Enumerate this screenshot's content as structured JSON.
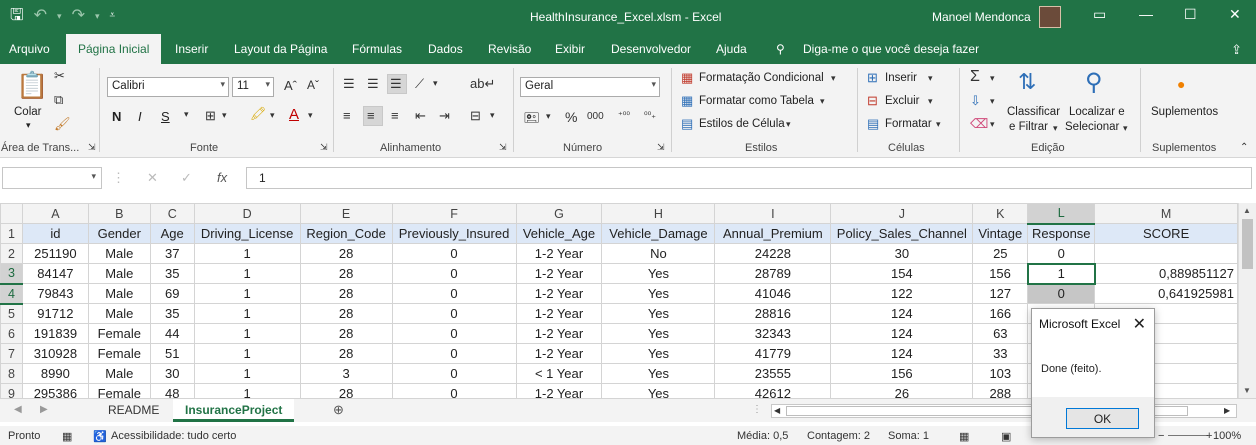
{
  "titlebar": {
    "title": "HealthInsurance_Excel.xlsm  -  Excel",
    "user": "Manoel Mendonca",
    "save_icon": "save-icon",
    "undo_icon": "undo-icon",
    "redo_icon": "redo-icon"
  },
  "tabs": {
    "file": "Arquivo",
    "home": "Página Inicial",
    "insert": "Inserir",
    "page_layout": "Layout da Página",
    "formulas": "Fórmulas",
    "data": "Dados",
    "review": "Revisão",
    "view": "Exibir",
    "developer": "Desenvolvedor",
    "help": "Ajuda",
    "tell_me": "Diga-me o que você deseja fazer"
  },
  "ribbon": {
    "clipboard": {
      "paste": "Colar",
      "label": "Área de Trans..."
    },
    "font": {
      "name": "Calibri",
      "size": "11",
      "bold": "N",
      "italic": "I",
      "underline": "S",
      "label": "Fonte"
    },
    "alignment": {
      "label": "Alinhamento"
    },
    "number": {
      "format": "Geral",
      "label": "Número"
    },
    "styles": {
      "conditional": "Formatação Condicional",
      "as_table": "Formatar como Tabela",
      "cell_styles": "Estilos de Célula",
      "label": "Estilos"
    },
    "cells": {
      "insert": "Inserir",
      "delete": "Excluir",
      "format": "Formatar",
      "label": "Células"
    },
    "editing": {
      "sort_filter_1": "Classificar",
      "sort_filter_2": "e Filtrar",
      "find_1": "Localizar e",
      "find_2": "Selecionar",
      "label": "Edição"
    },
    "addins": {
      "title": "Suplementos",
      "label": "Suplementos"
    }
  },
  "formula_bar": {
    "name_box": "",
    "value": "1"
  },
  "sheet": {
    "columns": [
      "A",
      "B",
      "C",
      "D",
      "E",
      "F",
      "G",
      "H",
      "I",
      "J",
      "K",
      "L",
      "M"
    ],
    "selected_column": "L",
    "rows": [
      {
        "num": "1",
        "cells": [
          "id",
          "Gender",
          "Age",
          "Driving_License",
          "Region_Code",
          "Previously_Insured",
          "Vehicle_Age",
          "Vehicle_Damage",
          "Annual_Premium",
          "Policy_Sales_Channel",
          "Vintage",
          "Response",
          "SCORE"
        ]
      },
      {
        "num": "2",
        "cells": [
          "251190",
          "Male",
          "37",
          "1",
          "28",
          "0",
          "1-2 Year",
          "No",
          "24228",
          "30",
          "25",
          "0",
          ""
        ]
      },
      {
        "num": "3",
        "cells": [
          "84147",
          "Male",
          "35",
          "1",
          "28",
          "0",
          "1-2 Year",
          "Yes",
          "28789",
          "154",
          "156",
          "1",
          "0,889851127"
        ]
      },
      {
        "num": "4",
        "cells": [
          "79843",
          "Male",
          "69",
          "1",
          "28",
          "0",
          "1-2 Year",
          "Yes",
          "41046",
          "122",
          "127",
          "0",
          "0,641925981"
        ]
      },
      {
        "num": "5",
        "cells": [
          "91712",
          "Male",
          "35",
          "1",
          "28",
          "0",
          "1-2 Year",
          "Yes",
          "28816",
          "124",
          "166",
          "",
          ""
        ]
      },
      {
        "num": "6",
        "cells": [
          "191839",
          "Female",
          "44",
          "1",
          "28",
          "0",
          "1-2 Year",
          "Yes",
          "32343",
          "124",
          "63",
          "",
          ""
        ]
      },
      {
        "num": "7",
        "cells": [
          "310928",
          "Female",
          "51",
          "1",
          "28",
          "0",
          "1-2 Year",
          "Yes",
          "41779",
          "124",
          "33",
          "",
          ""
        ]
      },
      {
        "num": "8",
        "cells": [
          "8990",
          "Male",
          "30",
          "1",
          "3",
          "0",
          "< 1 Year",
          "Yes",
          "23555",
          "156",
          "103",
          "",
          ""
        ]
      },
      {
        "num": "9",
        "cells": [
          "295386",
          "Female",
          "48",
          "1",
          "28",
          "0",
          "1-2 Year",
          "Yes",
          "42612",
          "26",
          "288",
          "",
          ""
        ]
      }
    ]
  },
  "sheet_tabs": [
    "README",
    "InsuranceProject"
  ],
  "active_sheet": "InsuranceProject",
  "status": {
    "ready": "Pronto",
    "accessibility": "Acessibilidade: tudo certo",
    "average": "Média: 0,5",
    "count": "Contagem: 2",
    "sum": "Soma: 1",
    "zoom": "100%"
  },
  "dialog": {
    "title": "Microsoft Excel",
    "message": "Done (feito).",
    "ok": "OK"
  },
  "colors": {
    "excel_green": "#217346",
    "header_fill": "#dde8f7",
    "selection_gray": "#c6c6c6"
  }
}
